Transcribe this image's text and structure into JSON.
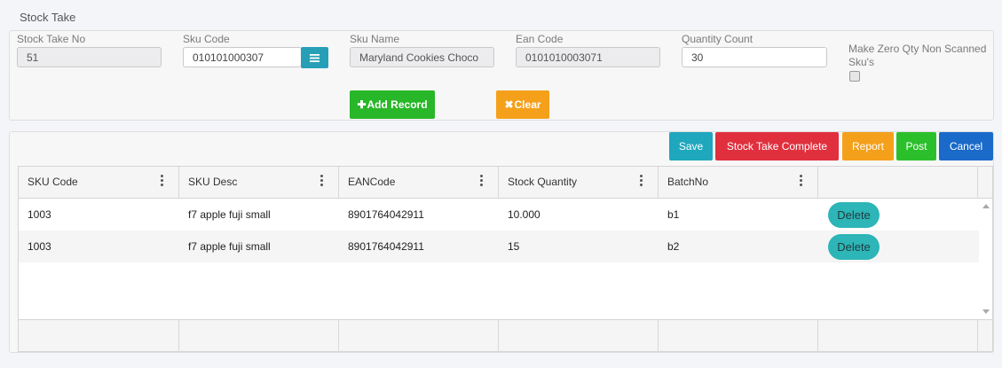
{
  "page": {
    "title": "Stock Take"
  },
  "form": {
    "stock_take_no": {
      "label": "Stock Take No",
      "value": "51"
    },
    "sku_code": {
      "label": "Sku Code",
      "value": "010101000307"
    },
    "sku_name": {
      "label": "Sku Name",
      "value": "Maryland Cookies Choco"
    },
    "ean_code": {
      "label": "Ean Code",
      "value": "0101010003071"
    },
    "quantity_count": {
      "label": "Quantity Count",
      "value": "30"
    },
    "zero_qty": {
      "label": "Make Zero Qty Non Scanned Sku's",
      "checked": false
    },
    "add_record": "Add Record",
    "clear": "Clear"
  },
  "actions": {
    "save": "Save",
    "stock_take_complete": "Stock Take Complete",
    "report": "Report",
    "post": "Post",
    "cancel": "Cancel"
  },
  "grid": {
    "columns": [
      "SKU Code",
      "SKU Desc",
      "EANCode",
      "Stock Quantity",
      "BatchNo"
    ],
    "delete_label": "Delete",
    "rows": [
      {
        "sku_code": "1003",
        "sku_desc": "f7 apple fuji small",
        "ean": "8901764042911",
        "qty": "10.000",
        "batch": "b1"
      },
      {
        "sku_code": "1003",
        "sku_desc": "f7 apple fuji small",
        "ean": "8901764042911",
        "qty": "15",
        "batch": "b2"
      }
    ]
  },
  "colors": {
    "add": "#28b728",
    "clear": "#f5a01a",
    "save": "#1fa7bd",
    "complete": "#e0303e",
    "report": "#f5a01a",
    "post": "#2bc02b",
    "cancel": "#1a6ac9",
    "delete": "#2db5b7"
  },
  "icons": {
    "sku_lookup": "menu-icon",
    "add": "plus-icon",
    "clear": "x-icon",
    "column_menu": "kebab-icon"
  }
}
